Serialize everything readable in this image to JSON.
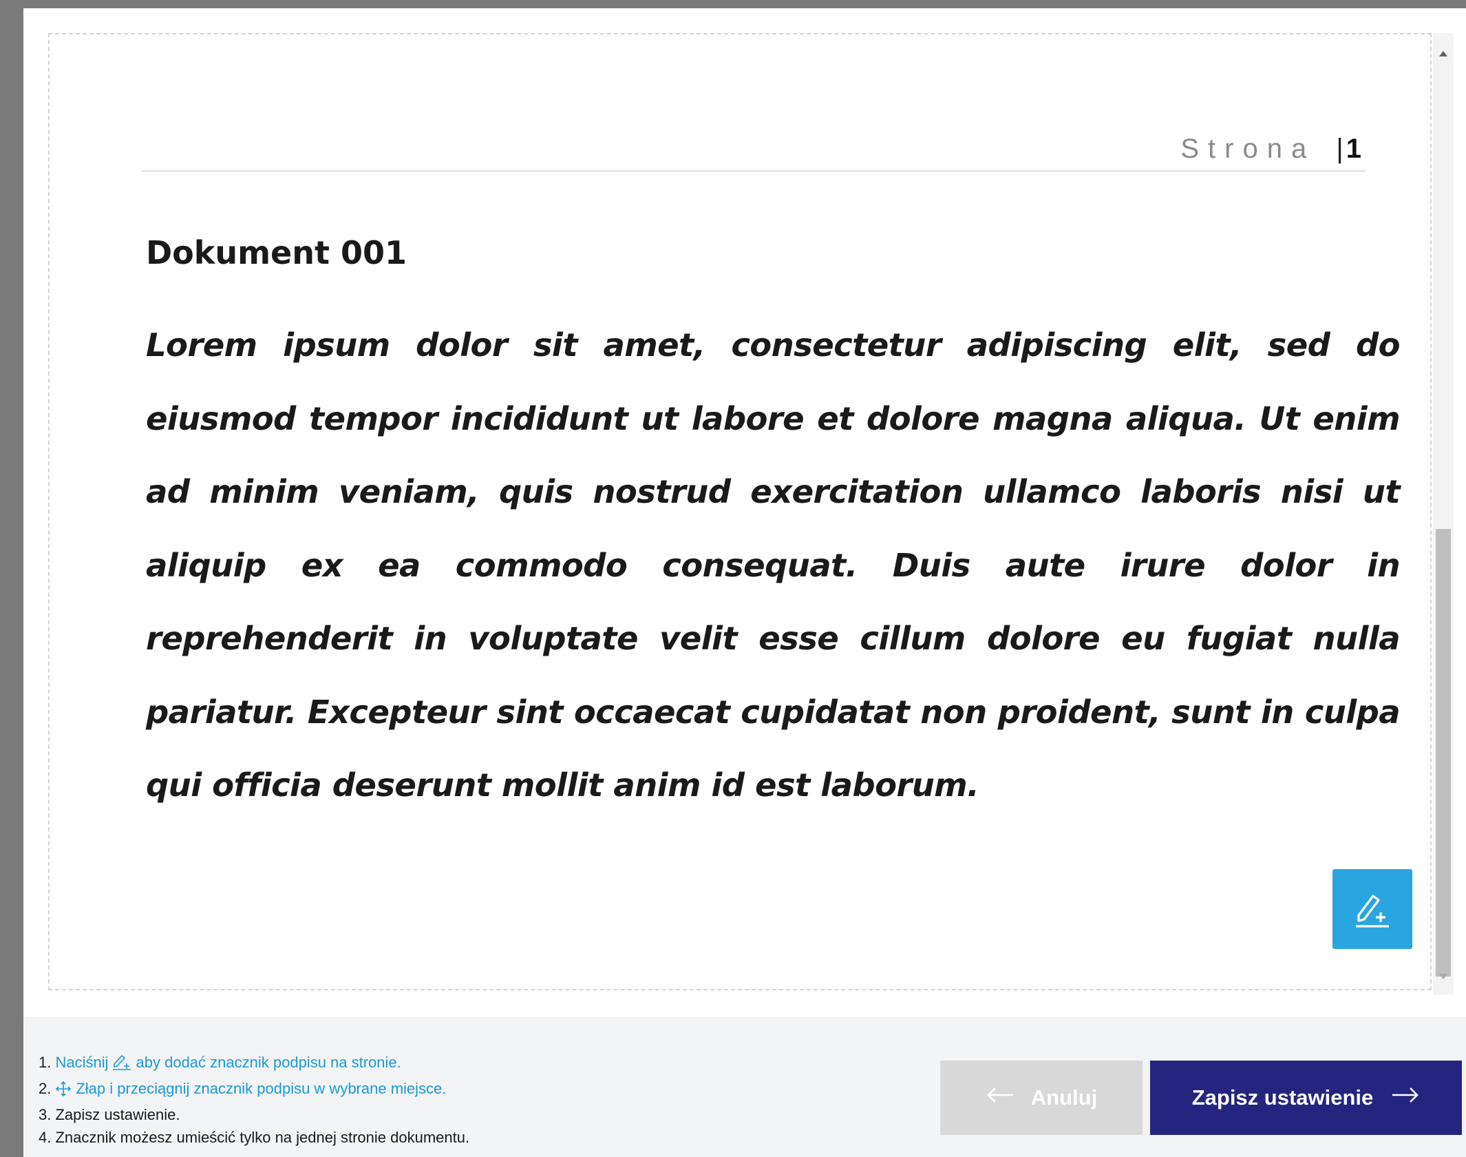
{
  "viewer": {
    "page_header": {
      "label": "Strona",
      "separator": "|",
      "number": "1"
    },
    "document": {
      "title": "Dokument 001",
      "body": "Lorem ipsum dolor sit amet, consectetur adipiscing elit, sed do eiusmod tempor incididunt ut labore et dolore magna aliqua. Ut enim ad minim veniam, quis nostrud exercitation ullamco laboris nisi ut aliquip ex ea commodo consequat. Duis aute irure dolor in reprehenderit in voluptate velit esse cillum dolore eu fugiat nulla pariatur. Excepteur sint occaecat cupidatat non proident, sunt in culpa qui officia deserunt mollit anim id est laborum."
    },
    "add_signature_button": {
      "icon": "signature-add-icon"
    }
  },
  "footer": {
    "instructions": [
      {
        "num": "1.",
        "before": "Naciśnij",
        "icon": "signature-add-icon",
        "after": "aby dodać znacznik podpisu na stronie."
      },
      {
        "num": "2.",
        "icon": "move-icon",
        "after": "Złap i przeciągnij znacznik podpisu w wybrane miejsce."
      },
      {
        "num": "3.",
        "text": "Zapisz ustawienie."
      },
      {
        "num": "4.",
        "text": "Znacznik możesz umieścić tylko na jednej stronie dokumentu."
      }
    ],
    "cancel_button": {
      "label": "Anuluj",
      "icon": "arrow-left-icon"
    },
    "save_button": {
      "label": "Zapisz ustawienie",
      "icon": "arrow-right-icon"
    }
  },
  "colors": {
    "accent": "#29a6e0",
    "link": "#1a9ad6",
    "primary": "#25257f",
    "disabled": "#d8d8d8"
  }
}
